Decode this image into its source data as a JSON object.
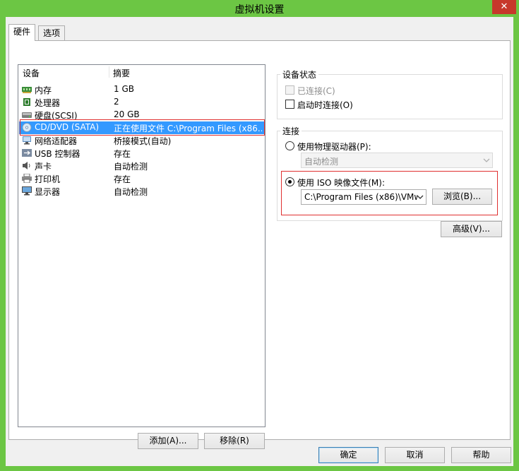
{
  "window": {
    "title": "虚拟机设置",
    "close_glyph": "✕"
  },
  "tabs": [
    {
      "label": "硬件",
      "active": true
    },
    {
      "label": "选项",
      "active": false
    }
  ],
  "device_list": {
    "columns": {
      "device": "设备",
      "summary": "摘要"
    },
    "rows": [
      {
        "name": "内存",
        "summary": "1 GB",
        "icon": "memory-icon"
      },
      {
        "name": "处理器",
        "summary": "2",
        "icon": "processor-icon"
      },
      {
        "name": "硬盘(SCSI)",
        "summary": "20 GB",
        "icon": "hard-disk-icon"
      },
      {
        "name": "CD/DVD (SATA)",
        "summary": "正在使用文件 C:\\Program Files (x86...",
        "icon": "cd-dvd-icon",
        "selected": true
      },
      {
        "name": "网络适配器",
        "summary": "桥接模式(自动)",
        "icon": "network-adapter-icon"
      },
      {
        "name": "USB 控制器",
        "summary": "存在",
        "icon": "usb-controller-icon"
      },
      {
        "name": "声卡",
        "summary": "自动检测",
        "icon": "sound-card-icon"
      },
      {
        "name": "打印机",
        "summary": "存在",
        "icon": "printer-icon"
      },
      {
        "name": "显示器",
        "summary": "自动检测",
        "icon": "display-icon"
      }
    ],
    "add_label": "添加(A)...",
    "remove_label": "移除(R)"
  },
  "device_status": {
    "title": "设备状态",
    "connected_label": "已连接(C)",
    "connected_checked": false,
    "connected_disabled": true,
    "connect_on_power_label": "启动时连接(O)",
    "connect_on_power_checked": false
  },
  "connection": {
    "title": "连接",
    "physical_drive_label": "使用物理驱动器(P):",
    "physical_drive_selected": false,
    "physical_drive_value": "自动检测",
    "iso_label": "使用 ISO 映像文件(M):",
    "iso_selected": true,
    "iso_path": "C:\\Program Files (x86)\\VMw",
    "browse_label": "浏览(B)..."
  },
  "advanced_label": "高级(V)...",
  "footer": {
    "ok_label": "确定",
    "cancel_label": "取消",
    "help_label": "帮助"
  }
}
